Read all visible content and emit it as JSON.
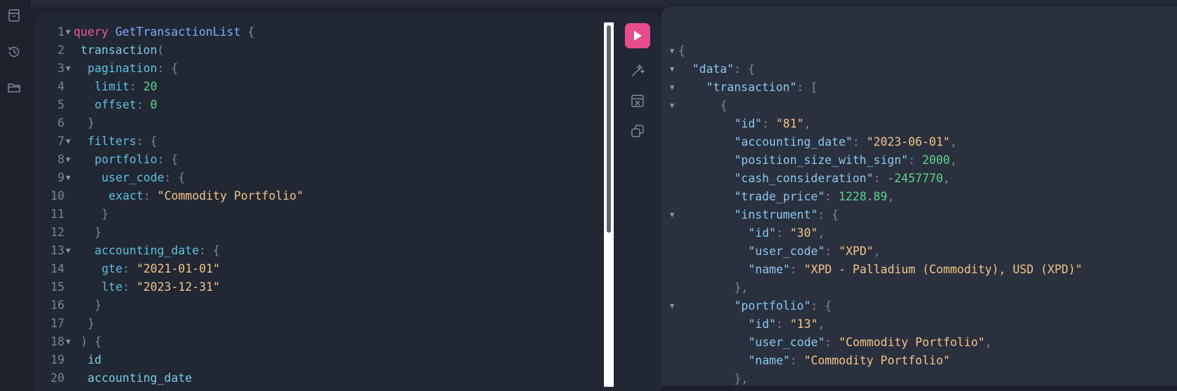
{
  "sidebar": {
    "icons": [
      "docs-icon",
      "history-icon",
      "folder-icon"
    ]
  },
  "editor": {
    "line_numbers": [
      "1",
      "2",
      "3",
      "4",
      "5",
      "6",
      "7",
      "8",
      "9",
      "10",
      "11",
      "12",
      "13",
      "14",
      "15",
      "16",
      "17",
      "18",
      "19",
      "20"
    ],
    "tokens": {
      "kw_query": "query",
      "op_name": "GetTransactionList",
      "brace_open": "{",
      "brace_close": "}",
      "paren_open": "(",
      "paren_close": ")",
      "colon": ":",
      "f_transaction": "transaction",
      "a_pagination": "pagination",
      "a_limit": "limit",
      "v_limit": "20",
      "a_offset": "offset",
      "v_offset": "0",
      "a_filters": "filters",
      "a_portfolio": "portfolio",
      "a_user_code": "user_code",
      "a_exact": "exact",
      "v_exact": "\"Commodity Portfolio\"",
      "a_accounting_date": "accounting_date",
      "a_gte": "gte",
      "v_gte": "\"2021-01-01\"",
      "a_lte": "lte",
      "v_lte": "\"2023-12-31\"",
      "f_id": "id",
      "f_accounting_date": "accounting_date"
    }
  },
  "toolbar": {
    "run_label": "Execute query",
    "icons": [
      "play-icon",
      "prettify-icon",
      "merge-fragments-icon",
      "copy-icon"
    ]
  },
  "result": {
    "tokens": {
      "brace_open": "{",
      "brace_close": "}",
      "bracket_open": "[",
      "colon": ":",
      "comma": ",",
      "close_comma": "},",
      "k_data": "\"data\"",
      "k_transaction": "\"transaction\"",
      "k_id": "\"id\"",
      "v_id": "\"81\"",
      "k_accounting_date": "\"accounting_date\"",
      "v_accounting_date": "\"2023-06-01\"",
      "k_position": "\"position_size_with_sign\"",
      "v_position": "2000",
      "k_cash": "\"cash_consideration\"",
      "v_cash": "-2457770",
      "k_trade_price": "\"trade_price\"",
      "v_trade_price": "1228.89",
      "k_instrument": "\"instrument\"",
      "v_instr_id": "\"30\"",
      "k_user_code": "\"user_code\"",
      "v_instr_user_code": "\"XPD\"",
      "k_name": "\"name\"",
      "v_instr_name": "\"XPD - Palladium (Commodity), USD (XPD)\"",
      "k_portfolio": "\"portfolio\"",
      "v_port_id": "\"13\"",
      "v_port_user_code": "\"Commodity Portfolio\"",
      "v_port_name": "\"Commodity Portfolio\""
    }
  },
  "colors": {
    "keyword": "#ec5f94",
    "operation": "#82aaff",
    "field": "#7ccbe8",
    "number": "#5fd38d",
    "string": "#f4c48a",
    "accent": "#e64d8c"
  }
}
